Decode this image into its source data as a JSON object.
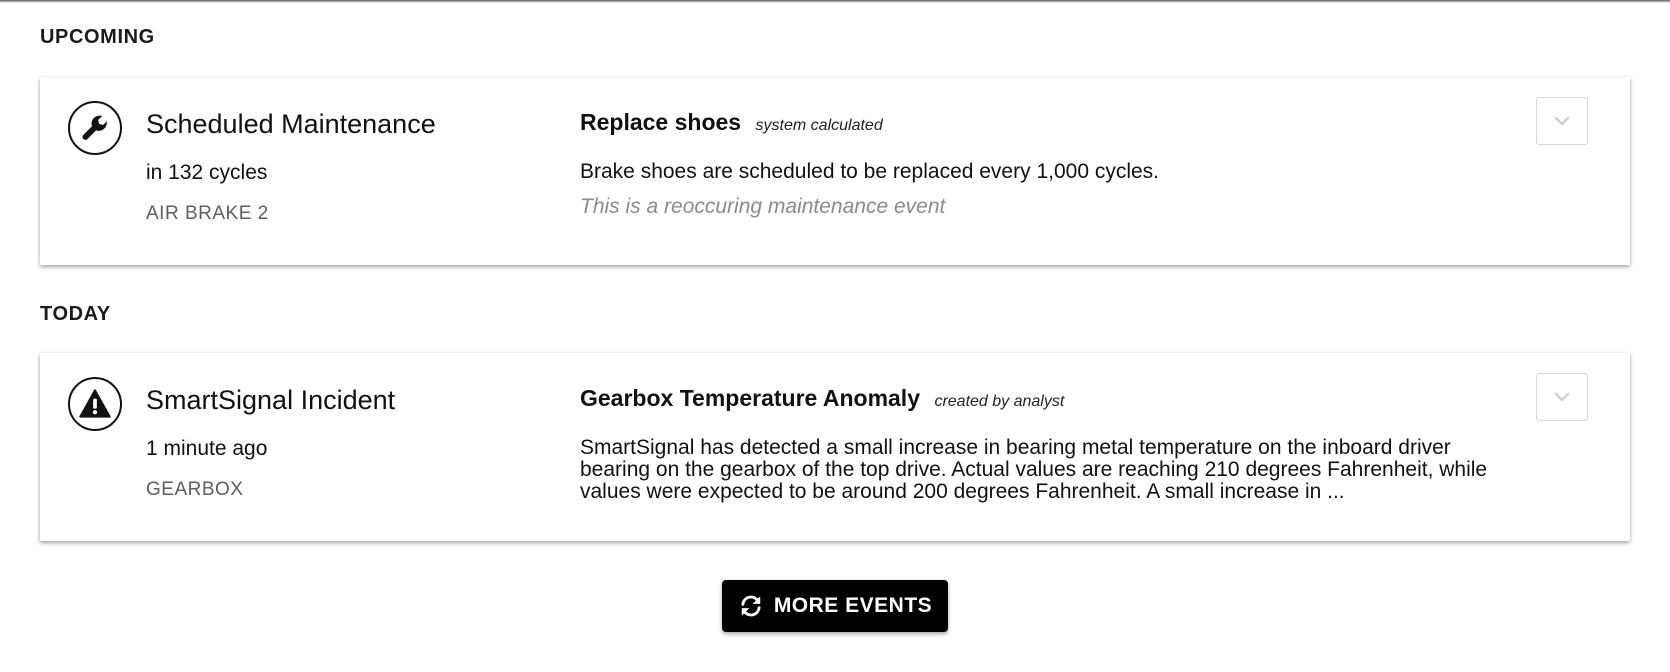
{
  "sections": [
    {
      "heading": "UPCOMING",
      "event": {
        "type": "Scheduled Maintenance",
        "icon": "wrench-icon",
        "when": "in 132 cycles",
        "asset": "AIR BRAKE 2",
        "title": "Replace shoes",
        "source": "system calculated",
        "description": "Brake shoes are scheduled to be replaced every 1,000 cycles.",
        "note": "This is a reoccuring maintenance event"
      }
    },
    {
      "heading": "TODAY",
      "event": {
        "type": "SmartSignal Incident",
        "icon": "warning-icon",
        "when": "1 minute ago",
        "asset": "GEARBOX",
        "title": "Gearbox Temperature Anomaly",
        "source": "created by analyst",
        "description": "SmartSignal has detected a small increase in bearing metal temperature on the inboard driver bearing on the gearbox of the top drive. Actual values are reaching 210 degrees Fahrenheit, while values were expected to be around 200 degrees Fahrenheit. A small increase in ..."
      }
    }
  ],
  "more_events": {
    "label": "MORE EVENTS",
    "icon": "refresh-icon"
  },
  "colors": {
    "button_background": "#000000",
    "asset_text": "#5e5e5e",
    "note_text": "#8a8a8a"
  }
}
